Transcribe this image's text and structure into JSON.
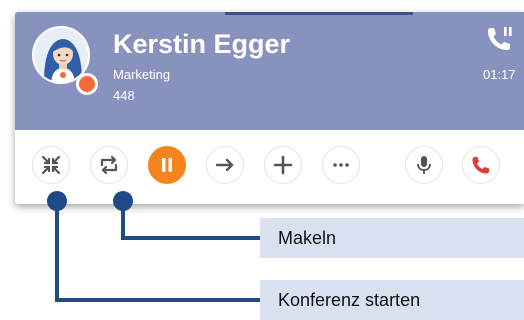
{
  "call": {
    "contact_name": "Kerstin Egger",
    "department": "Marketing",
    "extension": "448",
    "duration": "01:17",
    "presence_status_color": "#f26b3a",
    "header_color": "#8892bf"
  },
  "toolbar": {
    "buttons": [
      {
        "name": "conference",
        "icon": "merge-arrows-icon"
      },
      {
        "name": "swap-calls",
        "icon": "swap-arrows-icon"
      },
      {
        "name": "hold",
        "icon": "pause-icon",
        "color": "#f5841f"
      },
      {
        "name": "transfer",
        "icon": "arrow-right-icon"
      },
      {
        "name": "add-call",
        "icon": "plus-icon"
      },
      {
        "name": "more",
        "icon": "ellipsis-icon"
      },
      {
        "name": "mute",
        "icon": "microphone-icon"
      },
      {
        "name": "hang-up",
        "icon": "phone-hangup-icon",
        "color": "#e53935"
      }
    ]
  },
  "callouts": {
    "makeln": "Makeln",
    "konferenz": "Konferenz starten"
  },
  "accent_color": "#1f4a86"
}
